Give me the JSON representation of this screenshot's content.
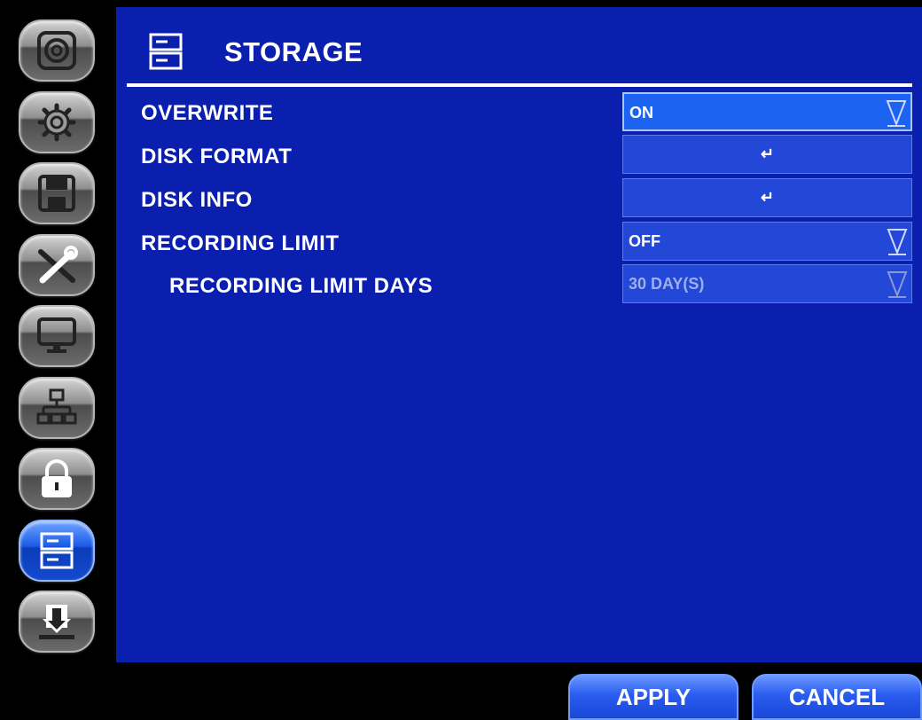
{
  "sidebar": {
    "items": [
      {
        "icon": "camera-icon"
      },
      {
        "icon": "gear-icon"
      },
      {
        "icon": "floppy-disk-icon"
      },
      {
        "icon": "tools-icon"
      },
      {
        "icon": "monitor-icon"
      },
      {
        "icon": "network-icon"
      },
      {
        "icon": "lock-icon"
      },
      {
        "icon": "storage-icon",
        "active": true
      },
      {
        "icon": "download-icon"
      }
    ]
  },
  "header": {
    "title": "STORAGE",
    "icon": "storage-icon"
  },
  "settings": [
    {
      "label": "OVERWRITE",
      "value": "ON",
      "control": "dropdown",
      "selected": true
    },
    {
      "label": "DISK FORMAT",
      "value": "↵",
      "control": "enter"
    },
    {
      "label": "DISK INFO",
      "value": "↵",
      "control": "enter"
    },
    {
      "label": "RECORDING LIMIT",
      "value": "OFF",
      "control": "dropdown"
    },
    {
      "label": "RECORDING LIMIT DAYS",
      "value": "30 DAY(S)",
      "control": "dropdown",
      "disabled": true
    }
  ],
  "footer": {
    "apply_label": "APPLY",
    "cancel_label": "CANCEL"
  },
  "colors": {
    "panel": "#0a1fae",
    "field": "#2348d8",
    "accent": "#1b63f0"
  }
}
